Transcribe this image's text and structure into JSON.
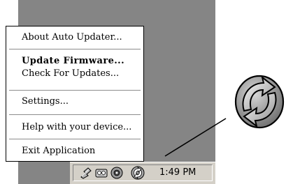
{
  "menu": {
    "items": [
      {
        "label": "About Auto Updater..."
      },
      {
        "label": "Update Firmware..."
      },
      {
        "label": "Check For Updates..."
      },
      {
        "label": "Settings..."
      },
      {
        "label": "Help with your device..."
      },
      {
        "label": "Exit Application"
      }
    ]
  },
  "taskbar": {
    "clock": "1:49 PM",
    "tray_icons": [
      "network-icon",
      "speaker-icon",
      "media-icon",
      "auto-updater-icon"
    ]
  },
  "callout_icon": "auto-updater-icon",
  "colors": {
    "desktop": "#858585",
    "taskbar": "#d4d0c8",
    "menu_bg": "#ffffff",
    "icon_gray": "#a0a0a0"
  }
}
